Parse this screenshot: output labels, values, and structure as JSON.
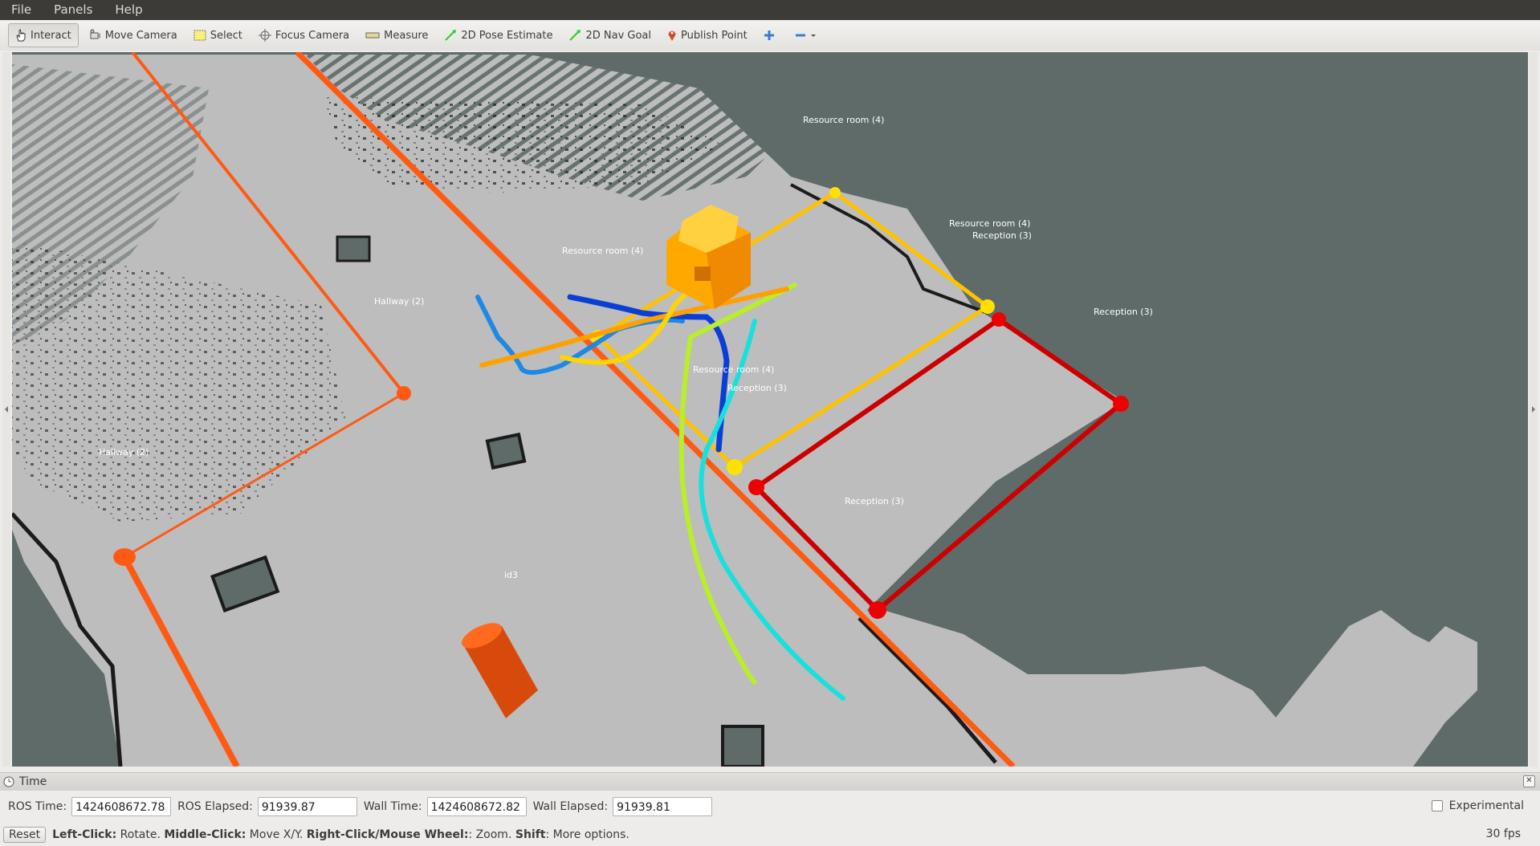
{
  "menu": {
    "file": "File",
    "panels": "Panels",
    "help": "Help"
  },
  "toolbar": {
    "interact": "Interact",
    "move_camera": "Move Camera",
    "select": "Select",
    "focus_camera": "Focus Camera",
    "measure": "Measure",
    "pose_estimate": "2D Pose Estimate",
    "nav_goal": "2D Nav Goal",
    "publish_point": "Publish Point"
  },
  "scene": {
    "labels": {
      "resource_room_top": "Resource room (4)",
      "resource_room_right": "Resource room (4)",
      "reception_right_small": "Reception (3)",
      "reception_far": "Reception (3)",
      "resource_room_center": "Resource room (4)",
      "reception_center": "Reception (3)",
      "reception_room": "Reception (3)",
      "resource_room_overlap": "Resource room (4)",
      "hallway_upper": "Hallway (2)",
      "hallway_left": "Hallway (2)",
      "id3": "id3"
    },
    "colors": {
      "map_free": "#bdbdbd",
      "map_unknown": "#5e6b69",
      "hallway_line": "#ff5a14",
      "resource_room_line": "#ffc200",
      "reception_line": "#cc0000",
      "robot": "#ffb400"
    }
  },
  "time_panel": {
    "title": "Time",
    "ros_time_label": "ROS Time:",
    "ros_time": "1424608672.78",
    "ros_elapsed_label": "ROS Elapsed:",
    "ros_elapsed": "91939.87",
    "wall_time_label": "Wall Time:",
    "wall_time": "1424608672.82",
    "wall_elapsed_label": "Wall Elapsed:",
    "wall_elapsed": "91939.81",
    "experimental_label": "Experimental",
    "experimental_checked": false
  },
  "status": {
    "reset_label": "Reset",
    "left_click_key": "Left-Click:",
    "left_click_text": " Rotate. ",
    "middle_click_key": "Middle-Click:",
    "middle_click_text": " Move X/Y. ",
    "right_click_key": "Right-Click/Mouse Wheel:",
    "right_click_text": ": Zoom. ",
    "shift_key": "Shift",
    "shift_text": ": More options.",
    "fps": "30 fps"
  }
}
